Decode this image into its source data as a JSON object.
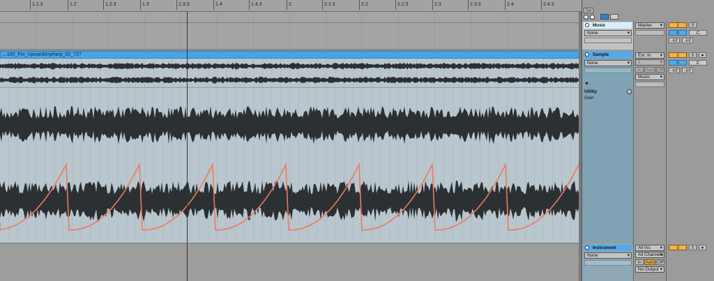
{
  "ruler": {
    "ticks": [
      "1.1.3",
      "1.2",
      "1.2.3",
      "1.3",
      "1.3.3",
      "1.4",
      "1.4.3",
      "2",
      "2.1.3",
      "2.2",
      "2.2.3",
      "2.3",
      "2.3.3",
      "2.4",
      "2.4.3"
    ]
  },
  "clip": {
    "name": "...100_Fm_UpwardArpHarp_02_727",
    "header_color": "#48a4e6",
    "envelope_color": "#ec7a5e"
  },
  "panel": {
    "set_label": "Set",
    "music": {
      "name": "Music",
      "input_select": "None",
      "output_select": "Master",
      "track_number": "1",
      "solo": "S",
      "volume": "0",
      "pan": "C",
      "peak_l": "-inf",
      "peak_r": "-inf"
    },
    "sample": {
      "name": "Sample",
      "input_select": "None",
      "input_type": "Ext. In",
      "input_channel": "1",
      "monitor": [
        "In",
        "Auto",
        "Off"
      ],
      "output_select": "Music",
      "track_number": "2",
      "solo": "S",
      "volume": "0",
      "pan": "C",
      "peak_l": "-inf",
      "peak_r": "-inf",
      "device": "Utility",
      "device_param": "Gain"
    },
    "instrument": {
      "name": "Instrument",
      "input_select": "None",
      "input_type": "All Ins",
      "input_channel": "All Channels",
      "monitor": [
        "In",
        "Auto",
        "Off"
      ],
      "output_select": "No Output",
      "track_number": "3",
      "solo": "S"
    }
  }
}
